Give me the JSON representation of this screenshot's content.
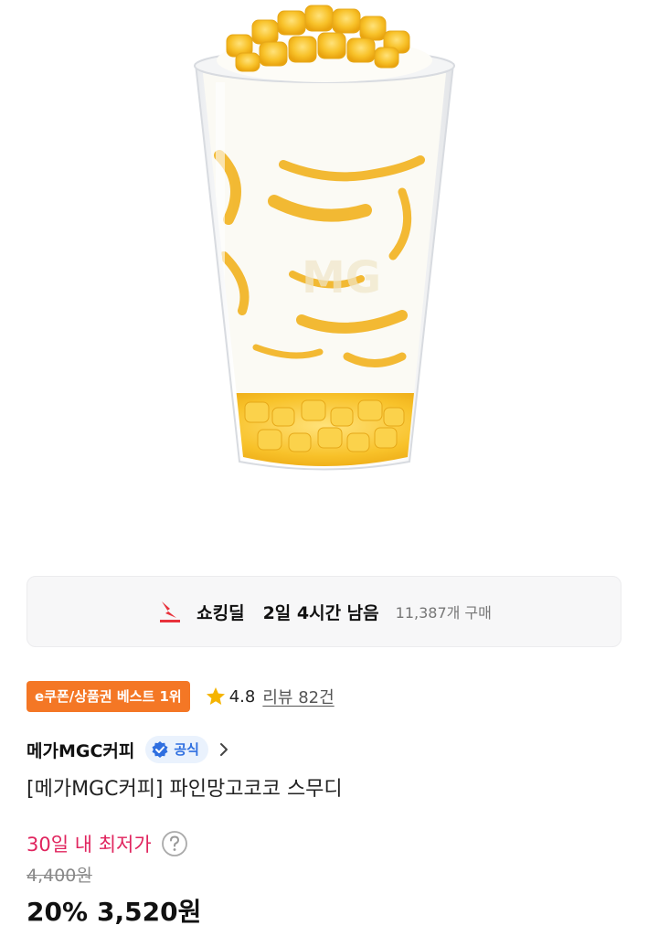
{
  "product_image": {
    "alt": "",
    "icon": "smoothie-cup-image"
  },
  "deal": {
    "icon": "shocking-deal-icon",
    "title": "쇼킹딜",
    "time_left": "2일 4시간 남음",
    "purchase_count": "11,387개 구매"
  },
  "badges": {
    "best": "e쿠폰/상품권 베스트 1위",
    "rating": "4.8",
    "review_link": "리뷰 82건"
  },
  "brand": {
    "name": "메가MGC커피",
    "official_label": "공식"
  },
  "product": {
    "title": "[메가MGC커피] 파인망고코코 스무디"
  },
  "price": {
    "lowest_label": "30일 내 최저가",
    "original": "4,400원",
    "discount": "20%",
    "sale": "3,520원"
  },
  "colors": {
    "accent_orange": "#f47725",
    "lowest_pink": "#e0245e",
    "official_blue": "#2f6fe0",
    "deal_red": "#e8323c"
  }
}
